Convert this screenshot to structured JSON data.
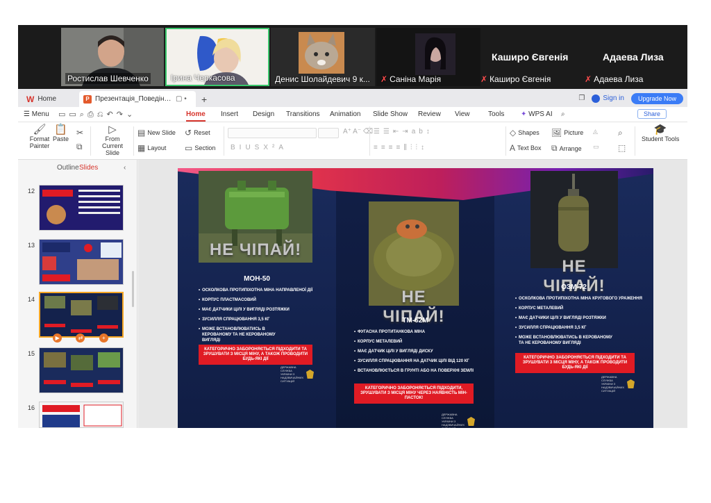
{
  "participants": [
    {
      "name": "Ростислав Шевченко"
    },
    {
      "name": "Ірина Черкасова"
    },
    {
      "name": "Денис Шолайдевич 9 к..."
    },
    {
      "name": "Саніна Марія",
      "muted": true
    }
  ],
  "named_tiles": [
    {
      "big": "Каширо Євгенія",
      "small": "Каширо Євгенія"
    },
    {
      "big": "Адаева Лиза",
      "small": "Адаева Лиза"
    }
  ],
  "tabbar": {
    "home": "Home",
    "doc_tab": "Презентація_Поведінка_під...",
    "add": "+",
    "sign_in": "Sign in",
    "upgrade": "Upgrade Now"
  },
  "menubar": {
    "menu": "Menu",
    "items": [
      "Home",
      "Insert",
      "Design",
      "Transitions",
      "Animation",
      "Slide Show",
      "Review",
      "View",
      "Tools",
      "WPS AI"
    ],
    "active": "Home",
    "share": "Share"
  },
  "ribbon": {
    "format_painter": "Format Painter",
    "paste": "Paste",
    "from_current_slide": "From Current Slide",
    "new_slide": "New Slide",
    "layout": "Layout",
    "reset": "Reset",
    "section": "Section",
    "shapes": "Shapes",
    "picture": "Picture",
    "text_box": "Text Box",
    "arrange": "Arrange",
    "student_tools": "Student Tools"
  },
  "panel": {
    "outline": "Outline",
    "slides": "Slides",
    "slide_numbers": [
      "12",
      "13",
      "14",
      "15",
      "16"
    ],
    "selected": "14"
  },
  "slide": {
    "photo_label": "НЕ ЧІПАЙ!",
    "mines": [
      {
        "title": "МОН-50",
        "bullets": [
          "ОСКОЛКОВА ПРОТИПІХОТНА МІНА НАПРАВЛЕНОЇ ДІЇ",
          "КОРПУС ПЛАСТМАСОВИЙ",
          "МАЄ ДАТЧИКИ ЦІЛІ У ВИГЛЯДІ РОЗТЯЖКИ",
          "ЗУСИЛЛЯ СПРАЦЮВАННЯ 3,5 КГ",
          "МОЖЕ ВСТАНОВЛЮВАТИСЬ В КЕРОВАНОМУ ТА НЕ КЕРОВАНОМУ ВИГЛЯДІ"
        ],
        "warning": "КАТЕГОРИЧНО ЗАБОРОНЯЄТЬСЯ ПІДХОДИТИ ТА ЗРУШУВАТИ З МІСЦЯ МІНУ, А ТАКОЖ ПРОВОДИТИ БУДЬ-ЯКІ ДІЇ"
      },
      {
        "title": "ТМ-62М",
        "bullets": [
          "ФУГАСНА ПРОТИТАНКОВА МІНА",
          "КОРПУС МЕТАЛЕВИЙ",
          "МАЄ ДАТЧИК ЦІЛІ У ВИГЛЯДІ ДИСКУ",
          "ЗУСИЛЛЯ СПРАЦЮВАННЯ НА ДАТЧИК ЦІЛІ ВІД 120 КГ",
          "ВСТАНОВЛЮЄТЬСЯ В ГРУНТІ АБО НА ПОВЕРХНІ ЗЕМЛІ"
        ],
        "warning": "КАТЕГОРИЧНО ЗАБОРОНЯЄТЬСЯ ПІДХОДИТИ, ЗРУШУВАТИ З МІСЦЯ МІНУ ЧЕРЕЗ НАЯВНІСТЬ МІН-ПАСТОК!"
      },
      {
        "title": "ОЗМ-72",
        "bullets": [
          "ОСКОЛКОВА ПРОТИПІХОТНА МІНА КРУГОВОГО УРАЖЕННЯ",
          "КОРПУС МЕТАЛЕВИЙ",
          "МАЄ ДАТЧИКИ ЦІЛІ У ВИГЛЯДІ РОЗТЯЖКИ",
          "ЗУСИЛЛЯ СПРАЦЮВАННЯ 3,5 КГ",
          "МОЖЕ ВСТАНОВЛЮВАТИСЬ В КЕРОВАНОМУ ТА НЕ КЕРОВАНОМУ ВИГЛЯДІ"
        ],
        "warning": "КАТЕГОРИЧНО ЗАБОРОНЯЄТЬСЯ ПІДХОДИТИ ТА ЗРУШУВАТИ З МІСЦЯ МІНУ, А ТАКОЖ ПРОВОДИТИ БУДЬ-ЯКІ ДІЇ"
      }
    ],
    "seal_text": "ДЕРЖАВНА СЛУЖБА УКРАЇНИ З НАДЗВИЧАЙНИХ СИТУАЦІЙ"
  },
  "colors": {
    "accent": "#d6342c",
    "upgrade": "#3b7cf6",
    "warning_red": "#e01b24",
    "active_speaker": "#39c76b",
    "slide_bg": "#101d44"
  }
}
